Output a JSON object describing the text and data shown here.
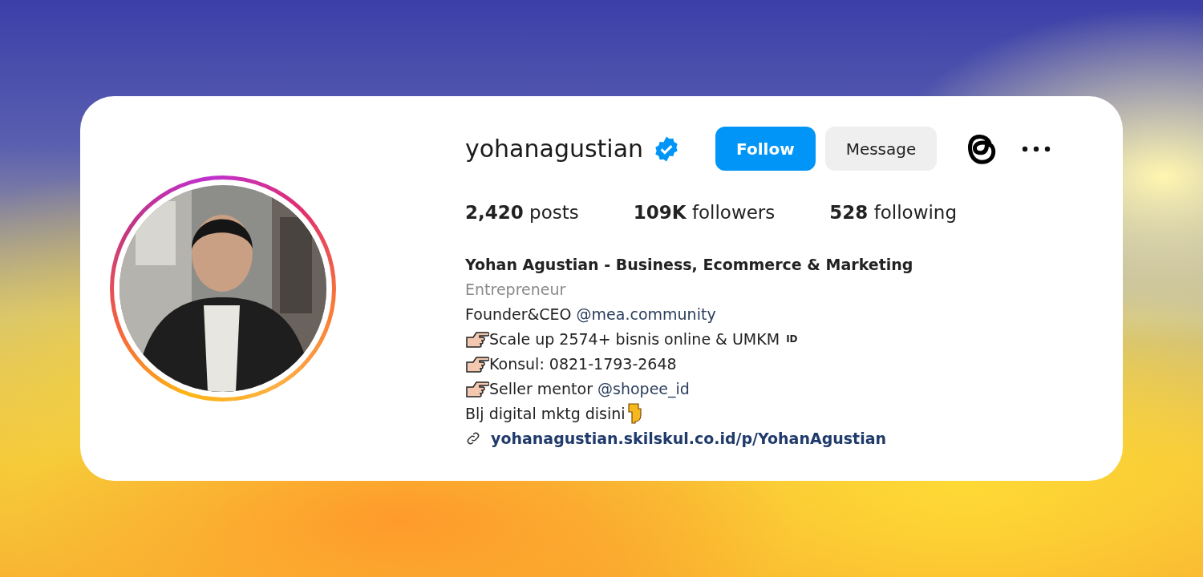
{
  "profile": {
    "username": "yohanagustian",
    "verified": true,
    "avatar": {
      "kind": "picture",
      "story_ring": true
    },
    "buttons": [
      {
        "label": "Follow",
        "kind": "primary"
      },
      {
        "label": "Message",
        "kind": "secondary"
      }
    ],
    "stats": [
      {
        "count": "2,420",
        "label": "posts"
      },
      {
        "count": "109K",
        "label": "followers"
      },
      {
        "count": "528",
        "label": "following"
      }
    ],
    "bio": {
      "name": "Yohan Agustian - Business, Ecommerce & Marketing",
      "category": "Entrepreneur",
      "lines": [
        {
          "parts": [
            {
              "kind": "text",
              "text": "Founder&CEO "
            },
            {
              "kind": "mention",
              "text": "@mea.community"
            }
          ]
        },
        {
          "parts": [
            {
              "kind": "hand_right"
            },
            {
              "kind": "text",
              "text": "Scale up 2574+ bisnis online & UMKM"
            },
            {
              "kind": "flag",
              "text": "ID"
            }
          ]
        },
        {
          "parts": [
            {
              "kind": "hand_right"
            },
            {
              "kind": "text",
              "text": "Konsul: 0821-1793-2648"
            }
          ]
        },
        {
          "parts": [
            {
              "kind": "hand_right"
            },
            {
              "kind": "text",
              "text": "Seller mentor "
            },
            {
              "kind": "mention",
              "text": "@shopee_id"
            }
          ]
        },
        {
          "parts": [
            {
              "kind": "text",
              "text": "Blj digital mktg disini"
            },
            {
              "kind": "hand_down"
            }
          ]
        }
      ],
      "link": "yohanagustian.skilskul.co.id/p/YohanAgustian"
    }
  }
}
